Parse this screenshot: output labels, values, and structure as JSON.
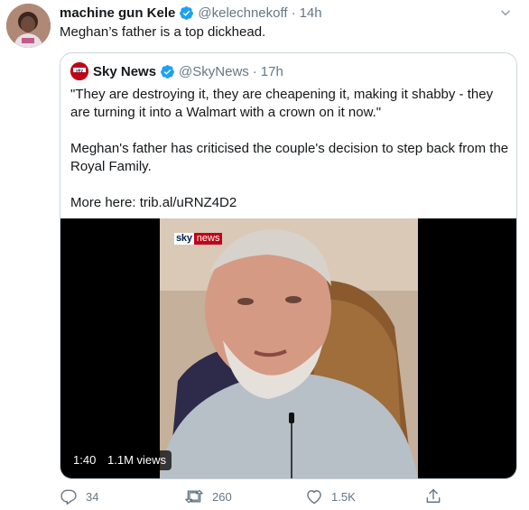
{
  "tweet": {
    "author_name": "machine gun Kele",
    "author_handle": "@kelechnekoff",
    "separator": "·",
    "time": "14h",
    "text": "Meghan’s father is a top dickhead.",
    "avatar_icon": "profile-avatar"
  },
  "quote": {
    "author_name": "Sky News",
    "author_handle": "@SkyNews",
    "separator": "·",
    "time": "17h",
    "avatar_text": "sky",
    "paragraphs": [
      "\"They are destroying it, they are cheapening it, making it shabby - they are turning it into a Walmart with a crown on it now.\"",
      "Meghan's father has criticised the couple's decision to step back from the Royal Family.",
      "More here: trib.al/uRNZ4D2"
    ],
    "video": {
      "logo_sky": "sky",
      "logo_news": "news",
      "duration": "1:40",
      "views": "1.1M views"
    }
  },
  "actions": {
    "reply_count": "34",
    "retweet_count": "260",
    "like_count": "1.5K",
    "icons": [
      "reply-icon",
      "retweet-icon",
      "like-icon",
      "share-icon"
    ]
  },
  "colors": {
    "accent": "#1da1f2",
    "muted": "#657786",
    "border": "#ccd6dd",
    "sky_red": "#c00418"
  }
}
